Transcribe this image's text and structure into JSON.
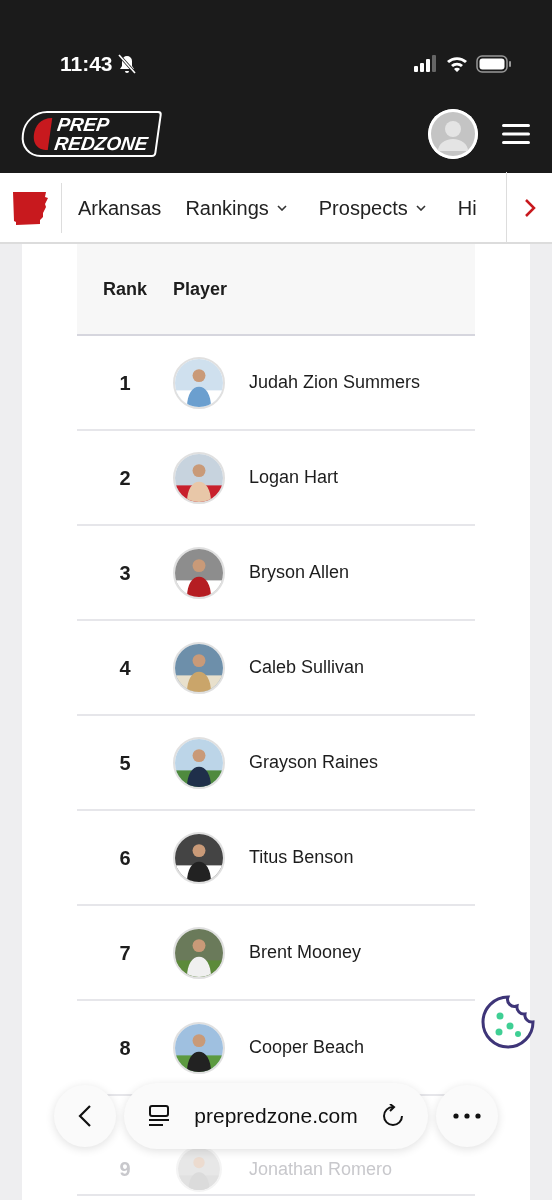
{
  "status_bar": {
    "time": "11:43",
    "silent": true
  },
  "header": {
    "logo_top": "PREP",
    "logo_bottom": "REDZONE"
  },
  "nav": {
    "items": [
      {
        "label": "Arkansas",
        "dropdown": false
      },
      {
        "label": "Rankings",
        "dropdown": true
      },
      {
        "label": "Prospects",
        "dropdown": true
      },
      {
        "label": "Hi",
        "dropdown": false
      }
    ]
  },
  "table": {
    "columns": [
      "Rank",
      "Player"
    ],
    "rows": [
      {
        "rank": "1",
        "name": "Judah Zion Summers"
      },
      {
        "rank": "2",
        "name": "Logan Hart"
      },
      {
        "rank": "3",
        "name": "Bryson Allen"
      },
      {
        "rank": "4",
        "name": "Caleb Sullivan"
      },
      {
        "rank": "5",
        "name": "Grayson Raines"
      },
      {
        "rank": "6",
        "name": "Titus Benson"
      },
      {
        "rank": "7",
        "name": "Brent Mooney"
      },
      {
        "rank": "8",
        "name": "Cooper Beach"
      },
      {
        "rank": "9",
        "name": "Jonathan Romero"
      }
    ]
  },
  "browser_bar": {
    "url": "prepredzone.com"
  }
}
